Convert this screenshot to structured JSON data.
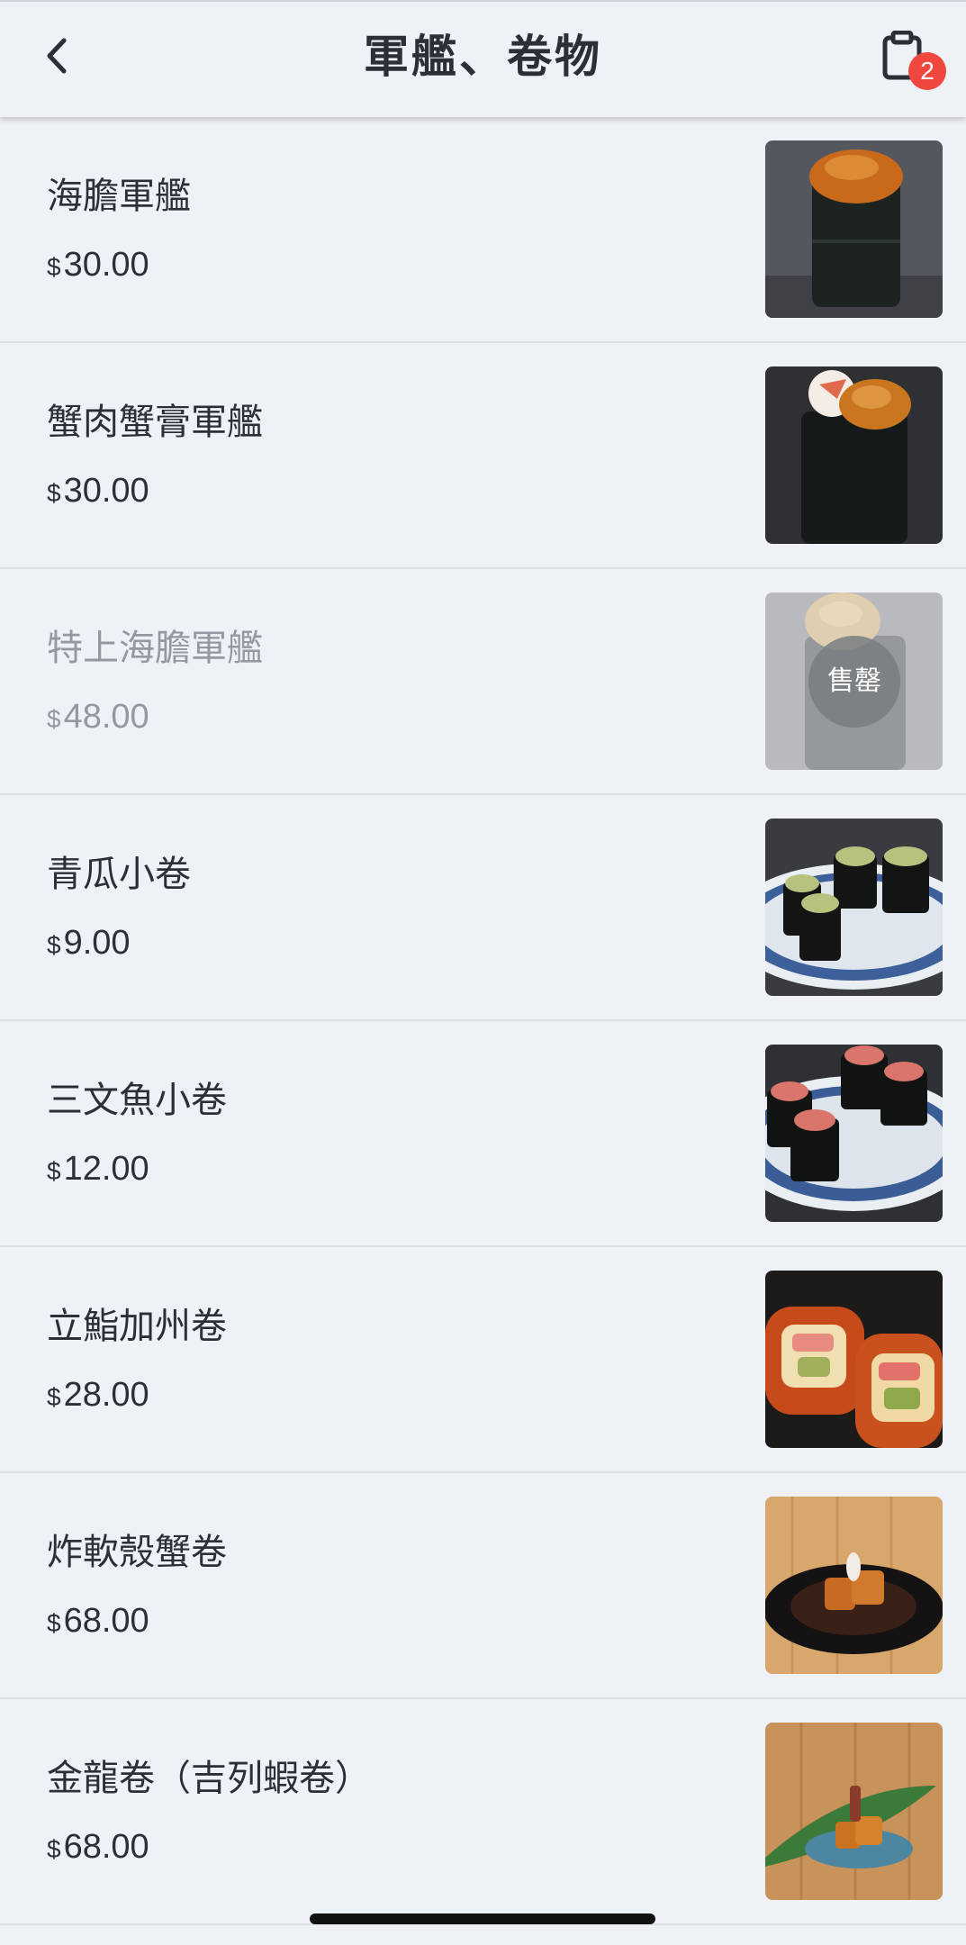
{
  "header": {
    "title": "軍艦、卷物",
    "back_icon": "chevron-left-icon",
    "cart_icon": "clipboard-icon",
    "cart_count": "2",
    "badge_color": "#f0483e"
  },
  "currency_symbol": "$",
  "sold_out_label": "售罄",
  "menu": {
    "items": [
      {
        "name": "海膽軍艦",
        "price": "30.00",
        "image": "sea-urchin-gunkan",
        "sold_out": false
      },
      {
        "name": "蟹肉蟹膏軍艦",
        "price": "30.00",
        "image": "crab-gunkan",
        "sold_out": false
      },
      {
        "name": "特上海膽軍艦",
        "price": "48.00",
        "image": "premium-sea-urchin-gunkan",
        "sold_out": true
      },
      {
        "name": "青瓜小卷",
        "price": "9.00",
        "image": "cucumber-roll",
        "sold_out": false
      },
      {
        "name": "三文魚小卷",
        "price": "12.00",
        "image": "salmon-roll",
        "sold_out": false
      },
      {
        "name": "立鮨加州卷",
        "price": "28.00",
        "image": "california-roll",
        "sold_out": false
      },
      {
        "name": "炸軟殼蟹卷",
        "price": "68.00",
        "image": "soft-shell-crab-roll",
        "sold_out": false
      },
      {
        "name": "金龍卷（吉列蝦卷）",
        "price": "68.00",
        "image": "golden-dragon-roll",
        "sold_out": false
      }
    ]
  }
}
